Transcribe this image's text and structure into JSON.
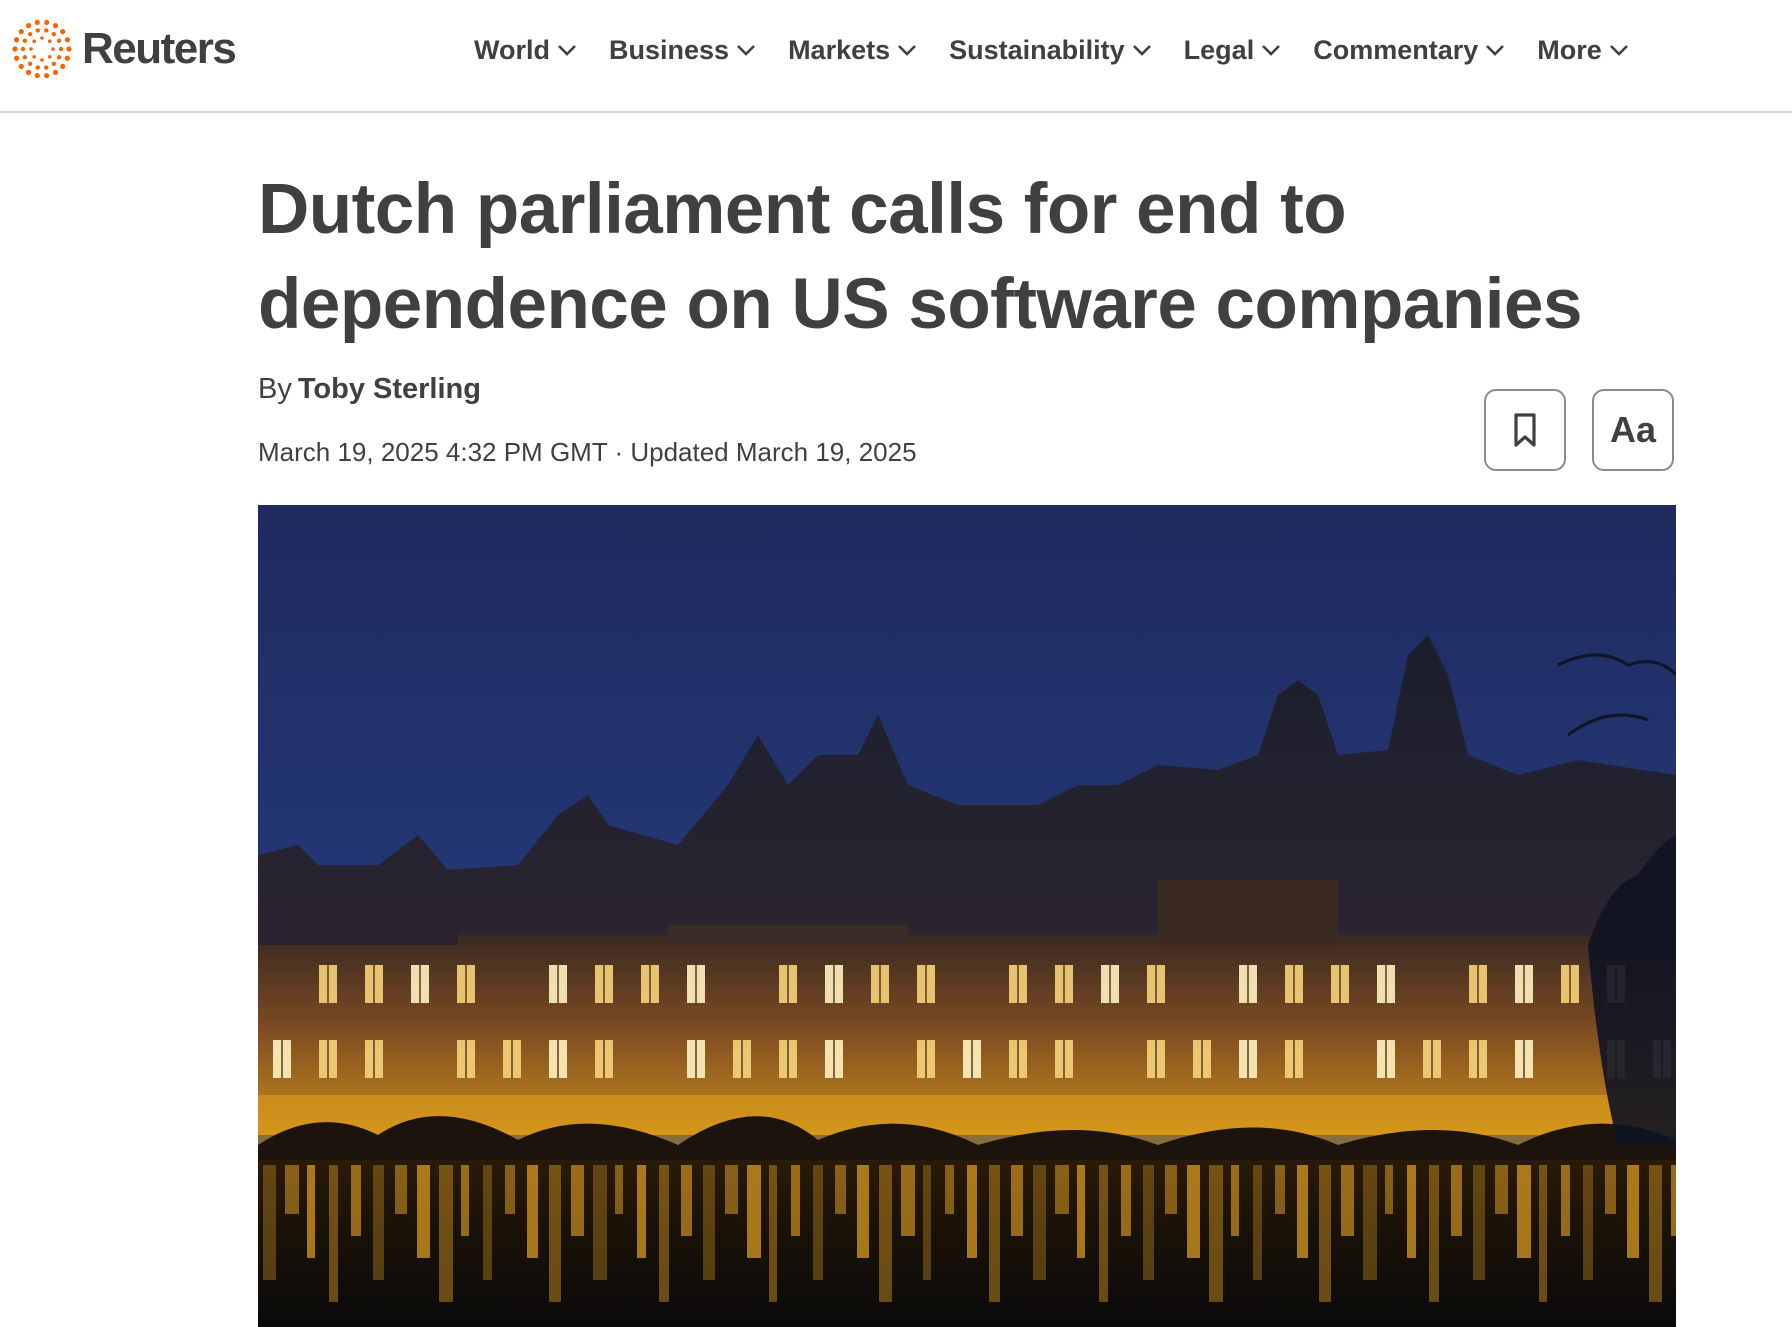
{
  "brand": {
    "name": "Reuters",
    "accent_color": "#fa6400",
    "logo_icon": "reuters-dots-logo-icon"
  },
  "nav": {
    "items": [
      {
        "label": "World",
        "icon": "chevron-down-icon"
      },
      {
        "label": "Business",
        "icon": "chevron-down-icon"
      },
      {
        "label": "Markets",
        "icon": "chevron-down-icon"
      },
      {
        "label": "Sustainability",
        "icon": "chevron-down-icon"
      },
      {
        "label": "Legal",
        "icon": "chevron-down-icon"
      },
      {
        "label": "Commentary",
        "icon": "chevron-down-icon"
      },
      {
        "label": "More",
        "icon": "chevron-down-icon"
      }
    ]
  },
  "article": {
    "headline_line1": "Dutch parliament calls for end to",
    "headline_line2": "dependence on US software companies",
    "by_prefix": "By",
    "author": "Toby Sterling",
    "dateline": "March 19, 2025 4:32 PM GMT · Updated March 19, 2025",
    "actions": {
      "bookmark_icon": "bookmark-icon",
      "text_size_label": "Aa"
    },
    "hero_image": {
      "subject": "night-view-of-building-reflected-in-pond"
    }
  }
}
